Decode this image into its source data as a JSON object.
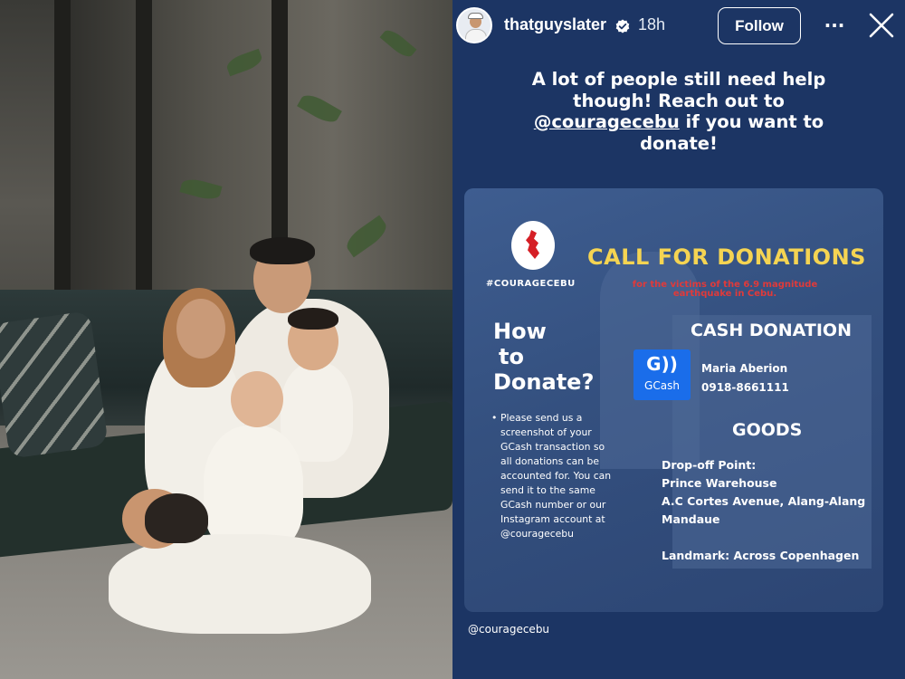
{
  "story": {
    "username": "thatguyslater",
    "time": "18h",
    "follow_label": "Follow",
    "more_label": "···",
    "caption_line1": "A lot of people still need help though! Reach out to",
    "caption_mention": "@couragecebu",
    "caption_line2": " if you want to donate!",
    "footer_mention": "@couragecebu"
  },
  "card": {
    "hashtag": "#COURAGECEBU",
    "title": "CALL FOR DONATIONS",
    "subtitle": "for the victims of the 6.9 magnitude earthquake in Cebu.",
    "how_line1": "How",
    "how_line2": "to",
    "how_line3": "Donate?",
    "instructions": "Please send us a screenshot of your GCash transaction so all donations can be accounted for.  You can send it to the same GCash number or our Instagram account at @couragecebu",
    "cash_title": "CASH DONATION",
    "gcash_icon_text": "G",
    "gcash_label": "GCash",
    "recipient_name": "Maria Aberion",
    "recipient_number": "0918-8661111",
    "goods_title": "GOODS",
    "dropoff_label": "Drop-off Point:",
    "dropoff_place": "Prince Warehouse",
    "dropoff_address": "A.C Cortes Avenue, Alang-Alang Mandaue",
    "landmark": "Landmark: Across Copenhagen"
  },
  "colors": {
    "story_bg": "#1c3564",
    "card_bg": "#3e5d90",
    "title_yellow": "#f5d452",
    "subtitle_red": "#e03a3a",
    "gcash_blue": "#1a6dea"
  }
}
